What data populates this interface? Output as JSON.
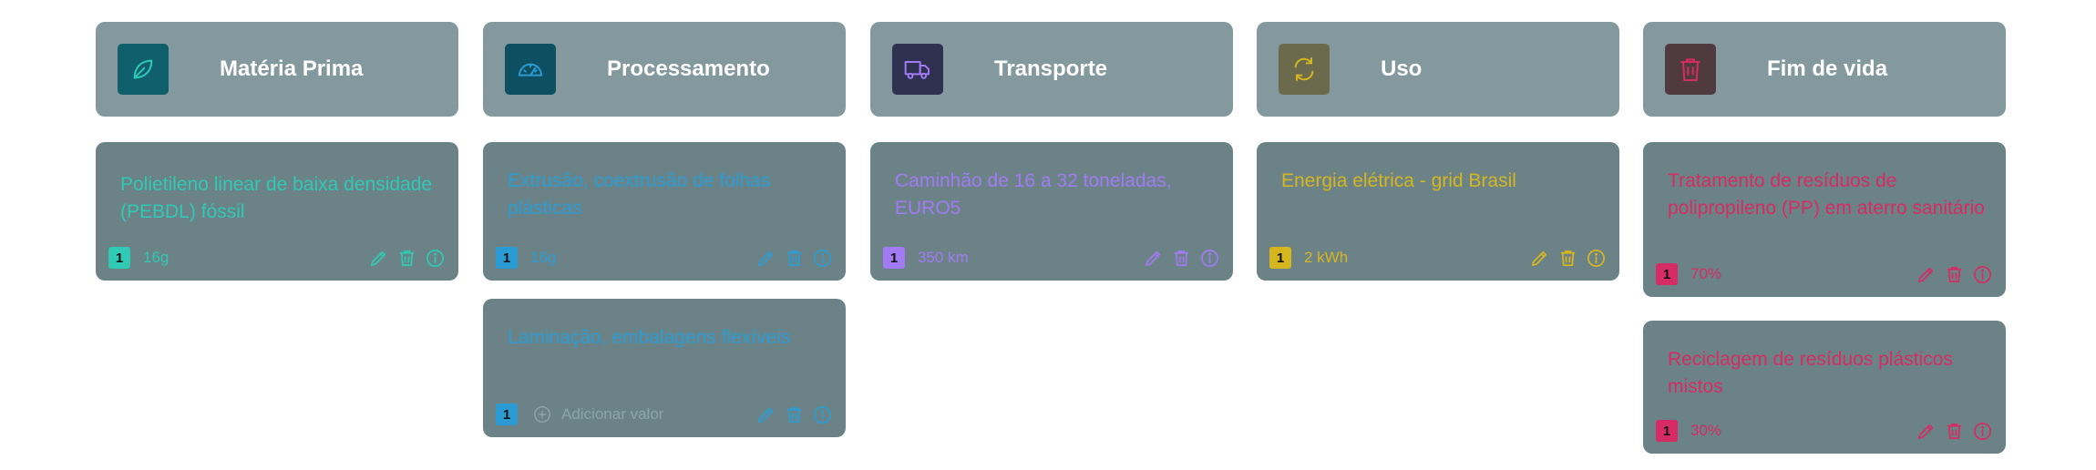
{
  "colors": {
    "header_bg": "#83999e",
    "card_bg": "#6b8387",
    "materia": "#2fc9b4",
    "processamento": "#2b9cd3",
    "transporte": "#a27af3",
    "uso": "#d6b61f",
    "fim": "#d62b64"
  },
  "columns": [
    {
      "key": "materia",
      "title": "Matéria Prima",
      "icon": "leaf-icon",
      "icon_bg": "#0f5f6d",
      "items": [
        {
          "text": "Polietileno linear de baixa densidade (PEBDL) fóssil",
          "badge": "1",
          "quantity": "16g"
        }
      ]
    },
    {
      "key": "processamento",
      "title": "Processamento",
      "icon": "gauge-icon",
      "icon_bg": "#0f4f62",
      "items": [
        {
          "text": "Extrusão, coextrusão de folhas plásticas",
          "badge": "1",
          "quantity": "16g"
        },
        {
          "text": "Laminação, embalagens flexíveis",
          "badge": "1",
          "add_label": "Adicionar valor"
        }
      ]
    },
    {
      "key": "transporte",
      "title": "Transporte",
      "icon": "truck-icon",
      "icon_bg": "#2e3150",
      "items": [
        {
          "text": "Caminhão de 16 a 32 toneladas, EURO5",
          "badge": "1",
          "quantity": "350 km"
        }
      ]
    },
    {
      "key": "uso",
      "title": "Uso",
      "icon": "refresh-icon",
      "icon_bg": "#6c6a4c",
      "items": [
        {
          "text": "Energia elétrica - grid Brasil",
          "badge": "1",
          "quantity": "2 kWh"
        }
      ]
    },
    {
      "key": "fim",
      "title": "Fim de vida",
      "icon": "trash-icon",
      "icon_bg": "#4f3a40",
      "items": [
        {
          "text": "Tratamento de resíduos de polipropileno (PP) em aterro sanitário",
          "badge": "1",
          "quantity": "70%"
        },
        {
          "text": "Reciclagem de resíduos plásticos mistos",
          "badge": "1",
          "quantity": "30%"
        }
      ]
    }
  ]
}
